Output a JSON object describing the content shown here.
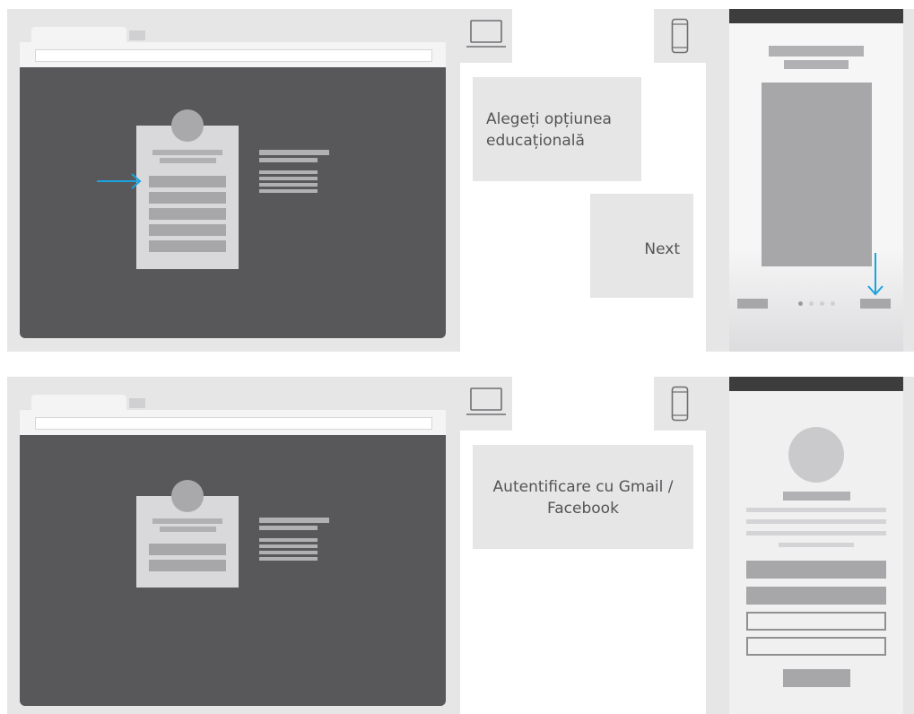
{
  "steps": [
    {
      "note": "Alegeți opțiunea educațională",
      "action": "Next",
      "desktop_icon": "laptop-icon",
      "mobile_icon": "smartphone-icon",
      "arrow_color": "#1aa3df"
    },
    {
      "note": "Autentificare cu Gmail / Facebook",
      "desktop_icon": "laptop-icon",
      "mobile_icon": "smartphone-icon"
    }
  ],
  "colors": {
    "panel": "#e6e6e7",
    "desktop_screen": "#58585a",
    "placeholder": "#b1b1b3",
    "mobile_header": "#3d3d3d",
    "accent_arrow": "#1aa3df"
  }
}
